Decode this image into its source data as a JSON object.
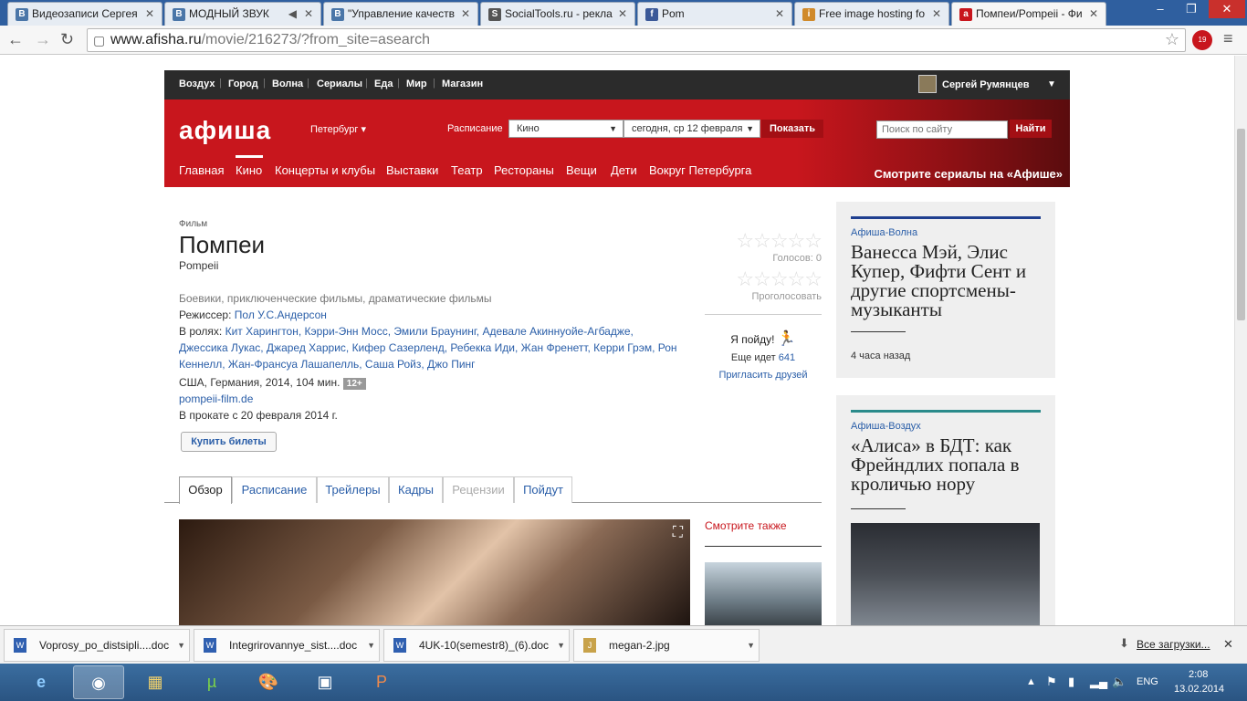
{
  "browser": {
    "tabs": [
      {
        "title": "Видеозаписи Сергея",
        "icon": "B",
        "color": "#4a76a8"
      },
      {
        "title": "МОДНЫЙ ЗВУК",
        "icon": "B",
        "color": "#4a76a8"
      },
      {
        "title": "\"Управление качеств",
        "icon": "B",
        "color": "#4a76a8"
      },
      {
        "title": "SocialTools.ru - рекла",
        "icon": "S",
        "color": "#555555"
      },
      {
        "title": "Pom",
        "icon": "f",
        "color": "#3b5998"
      },
      {
        "title": "Free image hosting fo",
        "icon": "i",
        "color": "#d08a2a"
      },
      {
        "title": "Помпеи/Pompeii - Фи",
        "icon": "a",
        "color": "#c8161d"
      }
    ],
    "url_domain": "www.afisha.ru",
    "url_path": "/movie/216273/?from_site=asearch",
    "ext_badge": "19"
  },
  "site": {
    "topnav": [
      "Воздух",
      "Город",
      "Волна",
      "Сериалы",
      "Еда",
      "Мир",
      "Магазин"
    ],
    "user_name": "Сергей Румянцев",
    "logo": "афиша",
    "city": "Петербург",
    "schedule_label": "Расписание",
    "category": "Кино",
    "date": "сегодня, ср 12 февраля",
    "show_button": "Показать",
    "search_placeholder": "Поиск по сайту",
    "search_button": "Найти",
    "menu": [
      "Главная",
      "Кино",
      "Концерты и клубы",
      "Выставки",
      "Театр",
      "Рестораны",
      "Вещи",
      "Дети",
      "Вокруг Петербурга"
    ],
    "promo": "Смотрите сериалы на «Афише»"
  },
  "movie": {
    "kind": "Фильм",
    "title": "Помпеи",
    "original": "Pompeii",
    "genres": "Боевики, приключенческие фильмы, драматические фильмы",
    "director_label": "Режиссер:",
    "director": "Пол У.С.Андерсон",
    "cast_label": "В ролях:",
    "cast": "Кит Харингтон, Кэрри-Энн Мосс, Эмили Браунинг, Адевале Акиннуойе-Агбадже, Джессика Лукас, Джаред Харрис, Кифер Сазерленд, Ребекка Иди, Жан Френетт, Керри Грэм, Рон Кеннелл, Жан-Франсуа Лашапелль, Саша Ройз, Джо Пинг",
    "country_year": "США, Германия, 2014, 104 мин.",
    "age": "12+",
    "site": "pompeii-film.de",
    "release": "В прокате с 20 февраля 2014 г.",
    "buy_button": "Купить билеты",
    "votes": "Голосов: 0",
    "vote_label": "Проголосовать",
    "going": "Я пойду!",
    "also_going_label": "Еще идет",
    "also_going_count": "641",
    "invite": "Пригласить друзей",
    "tabs": [
      "Обзор",
      "Расписание",
      "Трейлеры",
      "Кадры",
      "Рецензии",
      "Пойдут"
    ],
    "see_also": "Смотрите также"
  },
  "sidebar": [
    {
      "section": "Афиша-Волна",
      "headline": "Ванесса Мэй, Элис Купер, Фифти Сент и другие спортсмены-музыканты",
      "time": "4 часа назад",
      "accent": "#1f3f8f"
    },
    {
      "section": "Афиша-Воздух",
      "headline": "«Алиса» в БДТ: как Фрейндлих попала в кроличью нору",
      "accent": "#2a8a8a"
    }
  ],
  "downloads": {
    "items": [
      "Voprosy_po_distsipli....doc",
      "Integrirovannye_sist....doc",
      "4UK-10(semestr8)_(6).doc",
      "megan-2.jpg"
    ],
    "all_label": "Все загрузки..."
  },
  "taskbar": {
    "lang": "ENG",
    "time": "2:08",
    "date": "13.02.2014"
  }
}
